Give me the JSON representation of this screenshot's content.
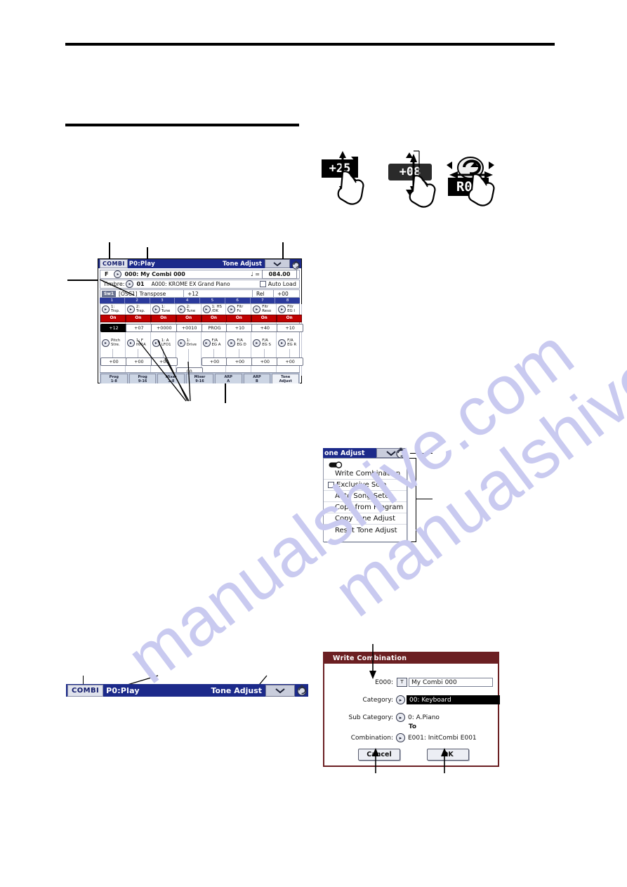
{
  "watermark": {
    "text": "manualshive.com"
  },
  "illustrations": {
    "slider_value": "+25",
    "button_value": "+08",
    "dial_value": "R08"
  },
  "lcd_main": {
    "titlebar": {
      "mode": "COMBI",
      "page": "P0:Play",
      "right_label": "Tone Adjust",
      "menu_icon": "chevron-down-icon",
      "knob_icon": "knob-icon"
    },
    "bank_row": {
      "bank": "F",
      "select_icon": "circle-arrow-icon",
      "combi_name": "000: My Combi 000",
      "tempo_note": "♩ =",
      "tempo_value": "084.00"
    },
    "timbre_row": {
      "label": "Timbre:",
      "select_icon": "circle-arrow-icon",
      "number": "01",
      "program": "A000: KROME EX Grand Piano",
      "auto_load_label": "Auto Load",
      "auto_load_checked": false
    },
    "param_row": {
      "sw_tag": "Sw1",
      "osc_tag": "[OSC1]",
      "param_name": "Transpose",
      "value": "+12",
      "rel_label": "Rel",
      "rel_value": "+00"
    },
    "number_bar": [
      "1",
      "2",
      "3",
      "4",
      "5",
      "6",
      "7",
      "8"
    ],
    "tone_cells_row1": [
      {
        "name": "1:\nTrsp.",
        "on": "On",
        "value": "+12",
        "selected": true
      },
      {
        "name": "2:\nTrsp.",
        "on": "On",
        "value": "+07",
        "selected": false
      },
      {
        "name": "1:\nTune",
        "on": "On",
        "value": "+0000",
        "selected": false
      },
      {
        "name": "2:\nTune",
        "on": "On",
        "value": "+0010",
        "selected": false
      },
      {
        "name": "1: HS\n/DK",
        "on": "On",
        "value": "PROG",
        "selected": false
      },
      {
        "name": "Fltr\nFc",
        "on": "On",
        "value": "+10",
        "selected": false
      },
      {
        "name": "Fltr\nReso",
        "on": "On",
        "value": "+40",
        "selected": false
      },
      {
        "name": "Fltr\nEG I",
        "on": "On",
        "value": "+10",
        "selected": false
      }
    ],
    "tone_cells_row2": [
      {
        "name": "Pitch\nStre.",
        "value": "+00"
      },
      {
        "name": "1: F\nlfo1A",
        "value": "+00"
      },
      {
        "name": "1: A\nLFO1",
        "value": "+00"
      },
      {
        "name": "1:\nDrive",
        "value": "00"
      },
      {
        "name": "F/A\nEG A",
        "value": "+00"
      },
      {
        "name": "F/A\nEG D",
        "value": "+00"
      },
      {
        "name": "F/A\nEG S",
        "value": "+00"
      },
      {
        "name": "F/A\nEG R",
        "value": "+00"
      }
    ],
    "tabs": [
      {
        "line1": "Prog",
        "line2": "1-8",
        "active": false
      },
      {
        "line1": "Prog",
        "line2": "9-16",
        "active": false
      },
      {
        "line1": "Mixer",
        "line2": "1-8",
        "active": false
      },
      {
        "line1": "Mixer",
        "line2": "9-16",
        "active": false
      },
      {
        "line1": "ARP",
        "line2": "A",
        "active": false
      },
      {
        "line1": "ARP",
        "line2": "B",
        "active": false
      },
      {
        "line1": "Tone",
        "line2": "Adjust",
        "active": true
      }
    ]
  },
  "menu_popup": {
    "title": "one Adjust",
    "menu_icon": "chevron-down-icon",
    "knob_icon": "knob-icon",
    "pin_icon": "pin-icon",
    "items": [
      {
        "label": "Write Combination",
        "checkbox": false
      },
      {
        "label": "Exclusive Solo",
        "checkbox": true
      },
      {
        "label": "Auto Song Setup",
        "checkbox": false
      },
      {
        "label": "Copy from Program",
        "checkbox": false
      },
      {
        "label": "Copy Tone Adjust",
        "checkbox": false
      },
      {
        "label": "Reset Tone Adjust",
        "checkbox": false
      }
    ]
  },
  "lcd_bottom_bar": {
    "mode": "COMBI",
    "page": "P0:Play",
    "right_label": "Tone Adjust",
    "menu_icon": "chevron-down-icon",
    "knob_icon": "knob-icon"
  },
  "write_dialog": {
    "title": "Write Combination",
    "slot_label": "E000:",
    "text_button": "T",
    "name_value": "My Combi 000",
    "category_label": "Category:",
    "category_value": "00: Keyboard",
    "sub_category_label": "Sub Category:",
    "sub_category_value": "0: A.Piano",
    "to_label": "To",
    "combination_label": "Combination:",
    "combination_value": "E001: InitCombi E001",
    "cancel_label": "Cancel",
    "ok_label": "OK",
    "arrow_icon": "arrow-icon"
  },
  "colors": {
    "titlebar_blue": "#1c2a8a",
    "dialog_maroon": "#6b1f22",
    "on_red": "#c00000",
    "watermark_blue": "#c9caf0"
  }
}
